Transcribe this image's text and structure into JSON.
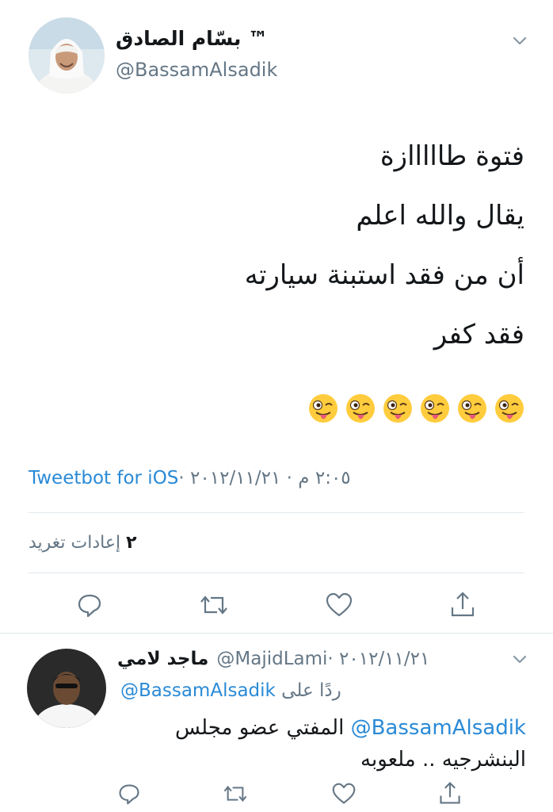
{
  "tweet": {
    "author_name": "بسّام الصادق ™",
    "author_handle": "@BassamAlsadik",
    "text_lines": [
      "فتوة طااااازة",
      "يقال والله اعلم",
      "أن من فقد استبنة سيارته",
      "فقد كفر"
    ],
    "emojis": "😜😜😜😜😜😜",
    "meta_date": "٢:٠٥ م · ٢٠١٢/١١/٢١ · ",
    "meta_source": "Tweetbot for iOS",
    "retweets_count": "٢",
    "retweets_label": "إعادات تغريد"
  },
  "reply": {
    "author_name": "ماجد لامي",
    "author_handle": "@MajidLami",
    "date": "٢٠١٢/١١/٢١ · ",
    "replying_prefix": "ردًا على",
    "replying_handle": "@BassamAlsadik",
    "mention": "@BassamAlsadik",
    "text_line1_rest": " المفتي عضو مجلس",
    "text_line2": "البنشرجيه .. ملعوبه"
  }
}
